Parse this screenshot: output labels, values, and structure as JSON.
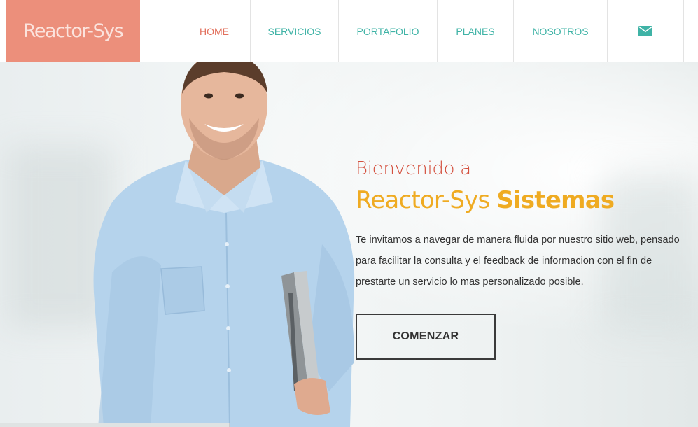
{
  "nav": {
    "logo": "Reactor-Sys",
    "items": [
      {
        "label": "HOME"
      },
      {
        "label": "SERVICIOS"
      },
      {
        "label": "PORTAFOLIO"
      },
      {
        "label": "PLANES"
      },
      {
        "label": "NOSOTROS"
      }
    ],
    "contact_icon": "envelope-icon",
    "active_color": "#e26f5b",
    "link_color": "#3fb3a6",
    "logo_bg": "#ec8f7b"
  },
  "hero": {
    "greeting": "Bienvenido a",
    "brand": "Reactor-Sys",
    "brand_bold": "Sistemas",
    "description": "Te invitamos a navegar de manera fluida por nuestro sitio web, pensado para facilitar la consulta y el feedback de informacion con el fin de prestarte un servicio lo mas personalizado posible.",
    "cta": "COMENZAR",
    "greeting_color": "#d4503e",
    "brand_color": "#efab22",
    "image": "man-with-laptop"
  }
}
